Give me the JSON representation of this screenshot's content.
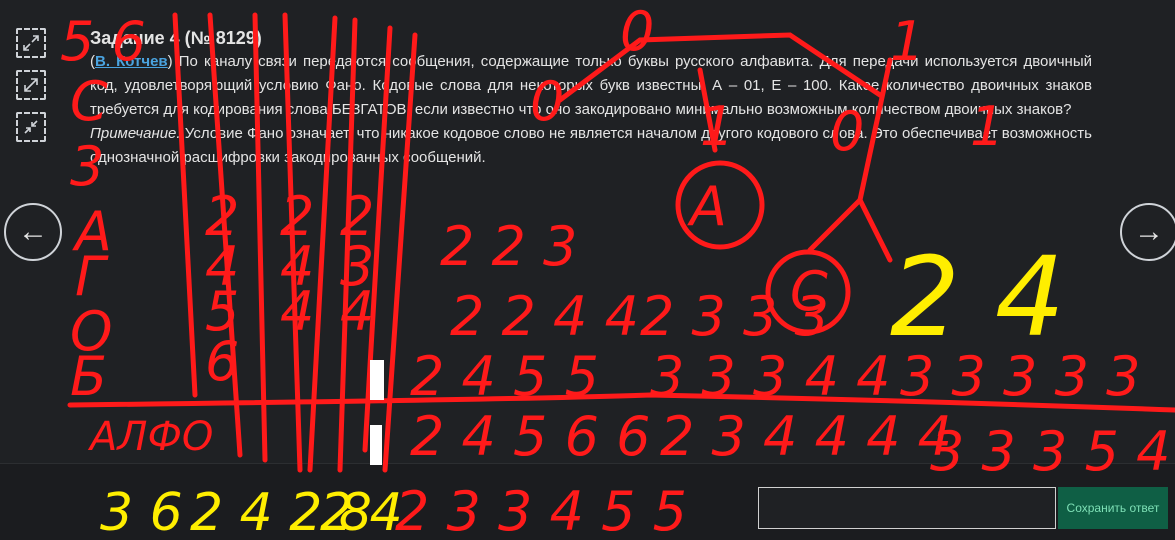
{
  "task": {
    "title": "Задание 4 (№ 8129)",
    "author_link": "В. Котчев",
    "paren_open": "(",
    "intro_rest": ") По каналу связи передаются сообщения, содержащие только буквы русского алфавита. Для передачи используется двоичный код, удовлетворяющий условию Фано. Кодовые слова для некоторых букв известны: А – 01, Е – 100. Какое количество двоичных знаков требуется для кодирования слова БЕЗГАТОВ, если известно что оно закодировано минимально возможным количеством двоичных знаков?",
    "note_label": "Примечание.",
    "note_text": " Условие Фано означает, что никакое кодовое слово не является началом другого кодового слова. Это обеспечивает возможность однозначной расшифровки закодированных сообщений."
  },
  "navigation": {
    "prev_arrow": "←",
    "next_arrow": "→"
  },
  "tools": [
    "expand-icon",
    "resize-diagonal-icon",
    "collapse-icon"
  ],
  "answer": {
    "value": "",
    "placeholder": "",
    "save_label": "Сохранить ответ"
  },
  "colors": {
    "background": "#1f2124",
    "red_ink": "#ff1a1a",
    "yellow_ink": "#ffee00",
    "link": "#4aa3df",
    "save_button": "#0f5f45"
  }
}
